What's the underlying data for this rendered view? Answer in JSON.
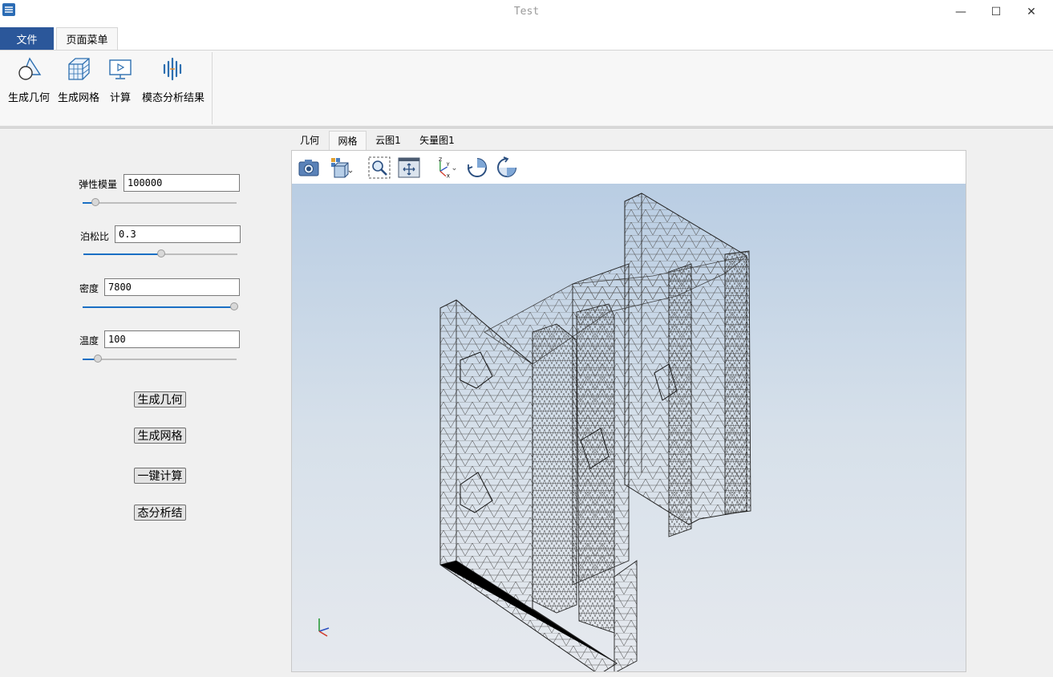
{
  "window": {
    "title": "Test",
    "minimize": "—",
    "maximize": "☐",
    "close": "✕"
  },
  "menu_tabs": {
    "file": "文件",
    "page_menu": "页面菜单"
  },
  "ribbon": {
    "items": [
      {
        "label": "生成几何",
        "icon": "geometry-icon"
      },
      {
        "label": "生成网格",
        "icon": "mesh-cube-icon"
      },
      {
        "label": "计算",
        "icon": "compute-monitor-icon"
      },
      {
        "label": "模态分析结果",
        "icon": "modal-wave-icon"
      }
    ]
  },
  "params": {
    "elastic_modulus": {
      "label": "弹性模量",
      "value": "100000",
      "slider": 0.08
    },
    "poisson_ratio": {
      "label": "泊松比",
      "value": "0.3",
      "slider": 0.5
    },
    "density": {
      "label": "密度",
      "value": "7800",
      "slider": 1.0
    },
    "temperature": {
      "label": "温度",
      "value": "100",
      "slider": 0.1
    }
  },
  "buttons": {
    "gen_geometry": "生成几何",
    "gen_mesh": "生成网格",
    "compute": "一键计算",
    "modal": "态分析结"
  },
  "view_tabs": [
    {
      "label": "几何",
      "active": false
    },
    {
      "label": "网格",
      "active": true
    },
    {
      "label": "云图1",
      "active": false
    },
    {
      "label": "矢量图1",
      "active": false
    }
  ],
  "viewer_toolbar": [
    "camera-icon",
    "display-mode-cube-icon",
    "zoom-box-icon",
    "fit-view-icon",
    "axis-orientation-icon",
    "rotate-cw-icon",
    "rotate-ccw-icon"
  ],
  "axes_labels": {
    "z": "Z",
    "y": "Y",
    "x": "X"
  },
  "colors": {
    "accent": "#2b579a",
    "slider_fill": "#1a6fc4",
    "mesh": "#222222"
  }
}
